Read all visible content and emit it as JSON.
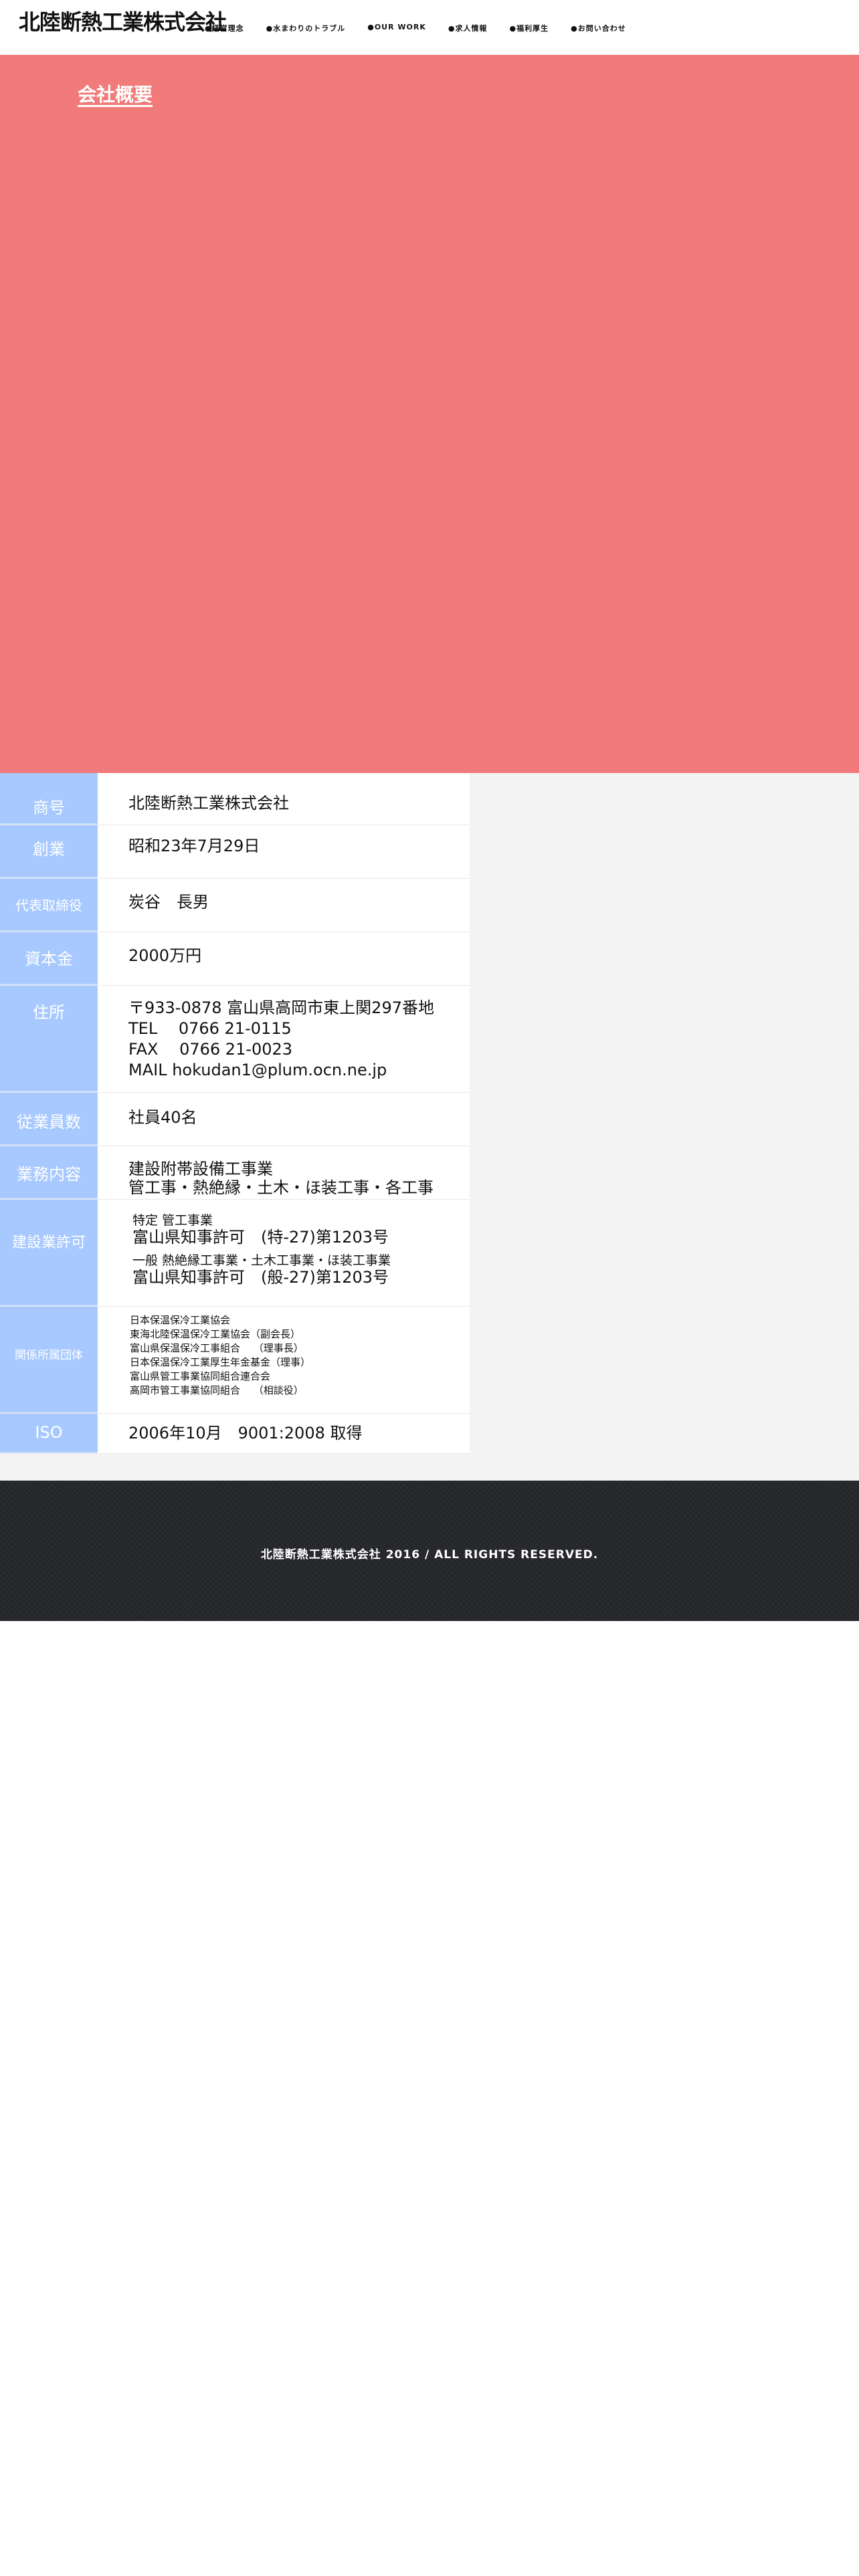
{
  "header": {
    "logo": "北陸断熱工業株式会社",
    "nav": [
      "●経営理念",
      "●水まわりのトラブル",
      "●OUR WORK",
      "●求人情報",
      "●福利厚生",
      "●お問い合わせ"
    ]
  },
  "hero": {
    "title": "会社概要"
  },
  "company": {
    "rows": [
      {
        "label": "商号",
        "lines": [
          "北陸断熱工業株式会社"
        ]
      },
      {
        "label": "創業",
        "lines": [
          "昭和23年7月29日"
        ]
      },
      {
        "label": "代表取締役",
        "lines": [
          "炭谷　長男"
        ]
      },
      {
        "label": "資本金",
        "lines": [
          "2000万円"
        ]
      },
      {
        "label": "住所",
        "lines": [
          "〒933-0878  富山県高岡市東上関297番地",
          "TEL　  0766 21-0115",
          "FAX　 0766 21-0023",
          "MAIL   hokudan1@plum.ocn.ne.jp"
        ]
      },
      {
        "label": "従業員数",
        "lines": [
          "社員40名"
        ]
      },
      {
        "label": "業務内容",
        "lines": [
          "建設附帯設備工事業",
          "管工事・熱絶縁・土木・ほ装工事・各工事"
        ]
      },
      {
        "label": "建設業許可",
        "lines": [
          "特定 管工事業",
          "富山県知事許可　(特-27)第1203号",
          "一般 熱絶縁工事業・土木工事業・ほ装工事業",
          "富山県知事許可　(般-27)第1203号"
        ]
      },
      {
        "label": "関係所属団体",
        "lines": [
          "日本保温保冷工業協会",
          "東海北陸保温保冷工業協会（副会長）",
          "富山県保温保冷工事組合　 （理事長）",
          "日本保温保冷工業厚生年金基金（理事）",
          "富山県管工事業協同組合連合会",
          "高岡市管工事業協同組合　 （相談役）"
        ]
      },
      {
        "label": "ISO",
        "lines": [
          "2006年10月　9001:2008 取得"
        ]
      }
    ]
  },
  "footer": {
    "copyright": "北陸断熱工業株式会社 2016  / ALL RIGHTS RESERVED."
  }
}
